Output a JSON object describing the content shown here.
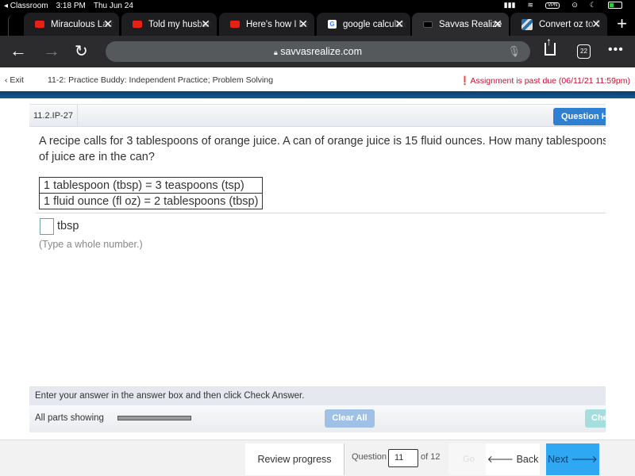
{
  "status_bar": {
    "back_app": "◂ Classroom",
    "time": "3:18 PM",
    "date": "Thu Jun 24",
    "vpn": "VPN"
  },
  "tabs": [
    {
      "label": "Miraculous Ladybug",
      "favicon": "youtube-icon",
      "active": false
    },
    {
      "label": "Told my husband",
      "favicon": "youtube-icon",
      "active": false
    },
    {
      "label": "Here's how I beat",
      "favicon": "youtube-icon",
      "active": false
    },
    {
      "label": "google calculator",
      "favicon": "google-icon",
      "active": false
    },
    {
      "label": "Savvas Realize",
      "favicon": "savvas-icon",
      "active": true
    },
    {
      "label": "Convert oz to fl oz",
      "favicon": "convert-icon",
      "active": false
    }
  ],
  "browser": {
    "url": "savvasrealize.com",
    "tab_count": "22"
  },
  "app_header": {
    "exit_label": "Exit",
    "breadcrumb": "11-2: Practice Buddy: Independent Practice; Problem Solving",
    "due_notice": "Assignment is past due (06/11/21 11:59pm)",
    "due_color": "#c8102e"
  },
  "question": {
    "id": "11.2.IP-27",
    "help_label": "Question Help",
    "line1": "A recipe calls for 3 tablespoons of orange juice. A can of orange juice is 15 fluid ounces. How many tablespoons",
    "line2": "of juice are in the can?",
    "conversions": [
      "1 tablespoon (tbsp) = 3 teaspoons (tsp)",
      "1 fluid ounce (fl oz) = 2 tablespoons (tbsp)"
    ],
    "answer_value": "",
    "answer_unit": "tbsp",
    "hint": "(Type a whole number.)"
  },
  "bottom_panel": {
    "instruction": "Enter your answer in the answer box and then click Check Answer.",
    "parts_label": "All parts showing",
    "parts_progress": 1.0,
    "clear_all_label": "Clear All",
    "check_answer_label": "Check Answer"
  },
  "footer": {
    "review_label": "Review progress",
    "question_label": "Question",
    "question_number": "11",
    "of_label": "of 12",
    "go_label": "Go",
    "back_label": "🡐 Back",
    "next_label": "Next 🡒",
    "next_color": "#2ea8f2"
  }
}
